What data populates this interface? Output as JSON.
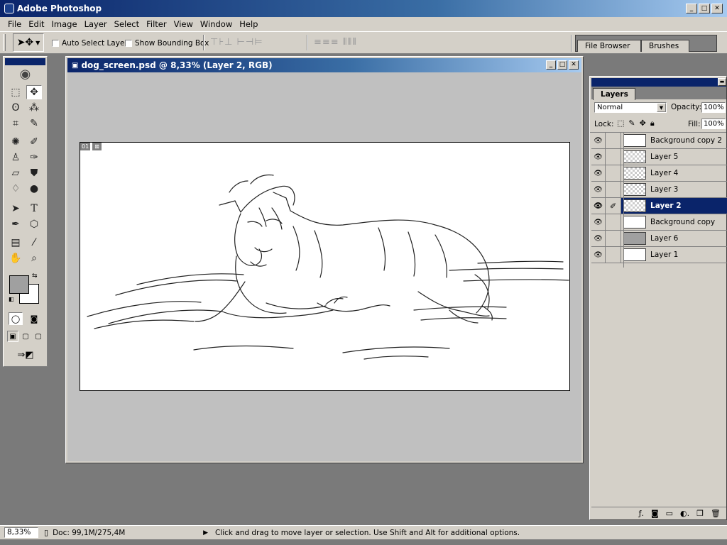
{
  "app": {
    "title": "Adobe Photoshop"
  },
  "menu": [
    "File",
    "Edit",
    "Image",
    "Layer",
    "Select",
    "Filter",
    "View",
    "Window",
    "Help"
  ],
  "options": {
    "auto_select_label": "Auto Select Layer",
    "bounding_box_label": "Show Bounding Box",
    "panel_tabs": [
      "File Browser",
      "Brushes"
    ]
  },
  "document": {
    "title": "dog_screen.psd @ 8,33% (Layer 2, RGB)",
    "canvas_badge": "01"
  },
  "layers_panel": {
    "tab": "Layers",
    "blend_mode": "Normal",
    "opacity_label": "Opacity:",
    "opacity_value": "100%",
    "lock_label": "Lock:",
    "fill_label": "Fill:",
    "fill_value": "100%",
    "layers": [
      {
        "name": "Background copy 2",
        "thumb": "sketch",
        "selected": false
      },
      {
        "name": "Layer 5",
        "thumb": "transparent",
        "selected": false
      },
      {
        "name": "Layer 4",
        "thumb": "transparent",
        "selected": false
      },
      {
        "name": "Layer 3",
        "thumb": "transparent",
        "selected": false
      },
      {
        "name": "Layer 2",
        "thumb": "transparent",
        "selected": true
      },
      {
        "name": "Background copy",
        "thumb": "sketch",
        "selected": false
      },
      {
        "name": "Layer 6",
        "thumb": "grey",
        "selected": false
      },
      {
        "name": "Layer 1",
        "thumb": "white",
        "selected": false
      }
    ]
  },
  "status": {
    "zoom": "8,33%",
    "doc": "Doc: 99,1M/275,4M",
    "message": "Click and drag to move layer or selection.  Use Shift and Alt for additional options."
  },
  "colors": {
    "titlebar": "#0a246a",
    "chrome": "#d4d0c8",
    "foreground_swatch": "#a0a0a0",
    "background_swatch": "#ffffff"
  }
}
